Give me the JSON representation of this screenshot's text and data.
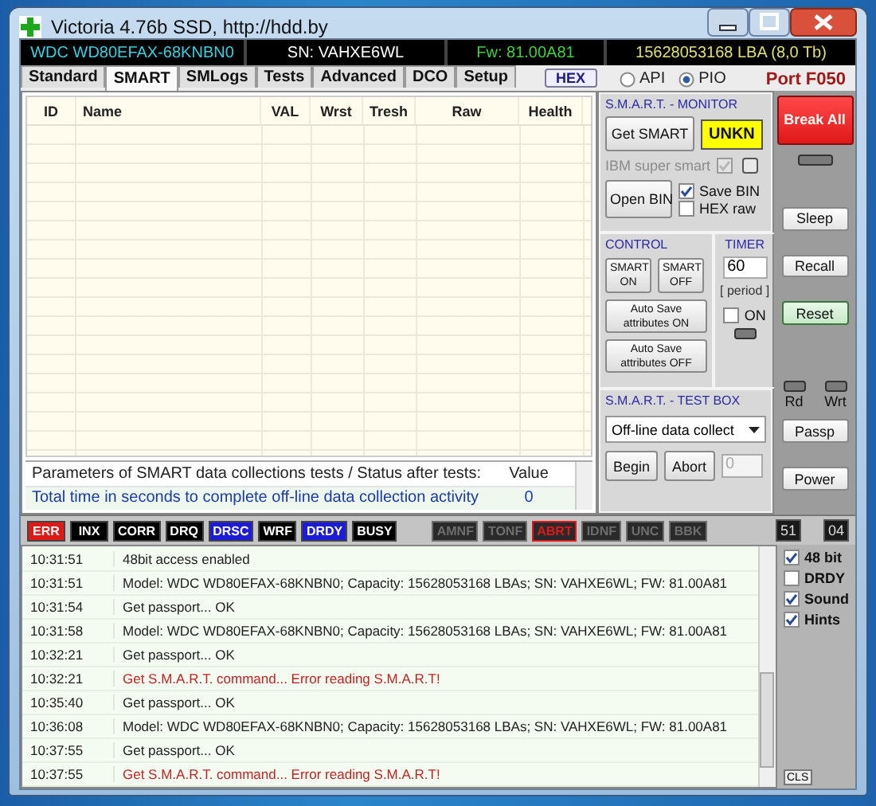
{
  "window": {
    "title": "Victoria 4.76b SSD, http://hdd.by"
  },
  "drive_bar": {
    "model": "WDC WD80EFAX-68KNBN0",
    "serial": "SN: VAHXE6WL",
    "firmware": "Fw: 81.00A81",
    "capacity": "15628053168 LBA (8,0 Tb)"
  },
  "tabs": [
    {
      "label": "Standard",
      "selected": false
    },
    {
      "label": "SMART",
      "selected": true
    },
    {
      "label": "SMLogs",
      "selected": false
    },
    {
      "label": "Tests",
      "selected": false
    },
    {
      "label": "Advanced",
      "selected": false
    },
    {
      "label": "DCO",
      "selected": false
    },
    {
      "label": "Setup",
      "selected": false
    }
  ],
  "hex_button": "HEX",
  "mode_radios": [
    {
      "label": "API",
      "selected": false
    },
    {
      "label": "PIO",
      "selected": true
    }
  ],
  "port": "Port F050",
  "smart_table": {
    "columns": [
      "ID",
      "Name",
      "VAL",
      "Wrst",
      "Tresh",
      "Raw",
      "Health"
    ]
  },
  "params_table": {
    "columns": [
      "Parameters of SMART data collections tests / Status after tests:",
      "Value"
    ],
    "rows": [
      {
        "parameter": "Total time in seconds to complete off-line data collection activity",
        "value": "0"
      }
    ]
  },
  "smart_monitor": {
    "title": "S.M.A.R.T. - MONITOR",
    "get_button": "Get SMART",
    "status": "UNKN",
    "ibm_super_smart": {
      "label": "IBM super smart",
      "checked": true,
      "disabled": true
    },
    "open_bin_button": "Open BIN",
    "options": [
      {
        "label": "Save BIN",
        "checked": true
      },
      {
        "label": "HEX raw",
        "checked": false
      }
    ]
  },
  "control": {
    "title": "CONTROL",
    "buttons": [
      "SMART ON",
      "SMART OFF",
      "Auto Save attributes ON",
      "Auto Save attributes OFF"
    ]
  },
  "timer": {
    "title": "TIMER",
    "value": "60",
    "unit": "[ period ]",
    "on": {
      "label": "ON",
      "checked": false
    }
  },
  "test_box": {
    "title": "S.M.A.R.T. - TEST BOX",
    "test": "Off-line data collect",
    "begin_button": "Begin",
    "abort_button": "Abort",
    "count": "0"
  },
  "side_buttons_top": [
    {
      "label": "Sleep",
      "kind": "normal"
    },
    {
      "label": "Recall",
      "kind": "normal"
    },
    {
      "label": "Reset",
      "kind": "default"
    }
  ],
  "break_button": "Break All",
  "leds": [
    "Rd",
    "Wrt"
  ],
  "side_buttons_bottom": [
    {
      "label": "Passp",
      "kind": "normal"
    },
    {
      "label": "Power",
      "kind": "normal"
    }
  ],
  "flags": [
    {
      "label": "ERR",
      "lit": true,
      "color": "#e01818"
    },
    {
      "label": "INX",
      "lit": true,
      "color": "#000000"
    },
    {
      "label": "CORR",
      "lit": true,
      "color": "#000000"
    },
    {
      "label": "DRQ",
      "lit": true,
      "color": "#000000"
    },
    {
      "label": "DRSC",
      "lit": true,
      "color": "#1c1cd8"
    },
    {
      "label": "WRF",
      "lit": true,
      "color": "#000000"
    },
    {
      "label": "DRDY",
      "lit": true,
      "color": "#1c1cd8"
    },
    {
      "label": "BUSY",
      "lit": true,
      "color": "#000000"
    }
  ],
  "error_flags": [
    {
      "label": "AMNF",
      "lit": false,
      "color": "#6e6e6e"
    },
    {
      "label": "TONF",
      "lit": false,
      "color": "#6e6e6e"
    },
    {
      "label": "ABRT",
      "lit": false,
      "color": "#e01818"
    },
    {
      "label": "IDNF",
      "lit": false,
      "color": "#6e6e6e"
    },
    {
      "label": "UNC",
      "lit": false,
      "color": "#6e6e6e"
    },
    {
      "label": "BBK",
      "lit": false,
      "color": "#6e6e6e"
    }
  ],
  "counters": [
    "51",
    "04"
  ],
  "log": [
    {
      "time": "10:31:51",
      "text": "48bit access enabled",
      "kind": "info"
    },
    {
      "time": "10:31:51",
      "text": "Model: WDC WD80EFAX-68KNBN0; Capacity: 15628053168 LBAs; SN: VAHXE6WL; FW: 81.00A81",
      "kind": "info"
    },
    {
      "time": "10:31:54",
      "text": "Get passport... OK",
      "kind": "info"
    },
    {
      "time": "10:31:58",
      "text": "Model: WDC WD80EFAX-68KNBN0; Capacity: 15628053168 LBAs; SN: VAHXE6WL; FW: 81.00A81",
      "kind": "info"
    },
    {
      "time": "10:32:21",
      "text": "Get passport... OK",
      "kind": "info"
    },
    {
      "time": "10:32:21",
      "text": "Get S.M.A.R.T. command... Error reading S.M.A.R.T!",
      "kind": "error"
    },
    {
      "time": "10:35:40",
      "text": "Get passport... OK",
      "kind": "info"
    },
    {
      "time": "10:36:08",
      "text": "Model: WDC WD80EFAX-68KNBN0; Capacity: 15628053168 LBAs; SN: VAHXE6WL; FW: 81.00A81",
      "kind": "info"
    },
    {
      "time": "10:37:55",
      "text": "Get passport... OK",
      "kind": "info"
    },
    {
      "time": "10:37:55",
      "text": "Get S.M.A.R.T. command... Error reading S.M.A.R.T!",
      "kind": "error"
    }
  ],
  "log_options": [
    {
      "label": "48 bit",
      "checked": true
    },
    {
      "label": "DRDY",
      "checked": false
    },
    {
      "label": "Sound",
      "checked": true
    },
    {
      "label": "Hints",
      "checked": true
    }
  ],
  "cls_button": "CLS"
}
